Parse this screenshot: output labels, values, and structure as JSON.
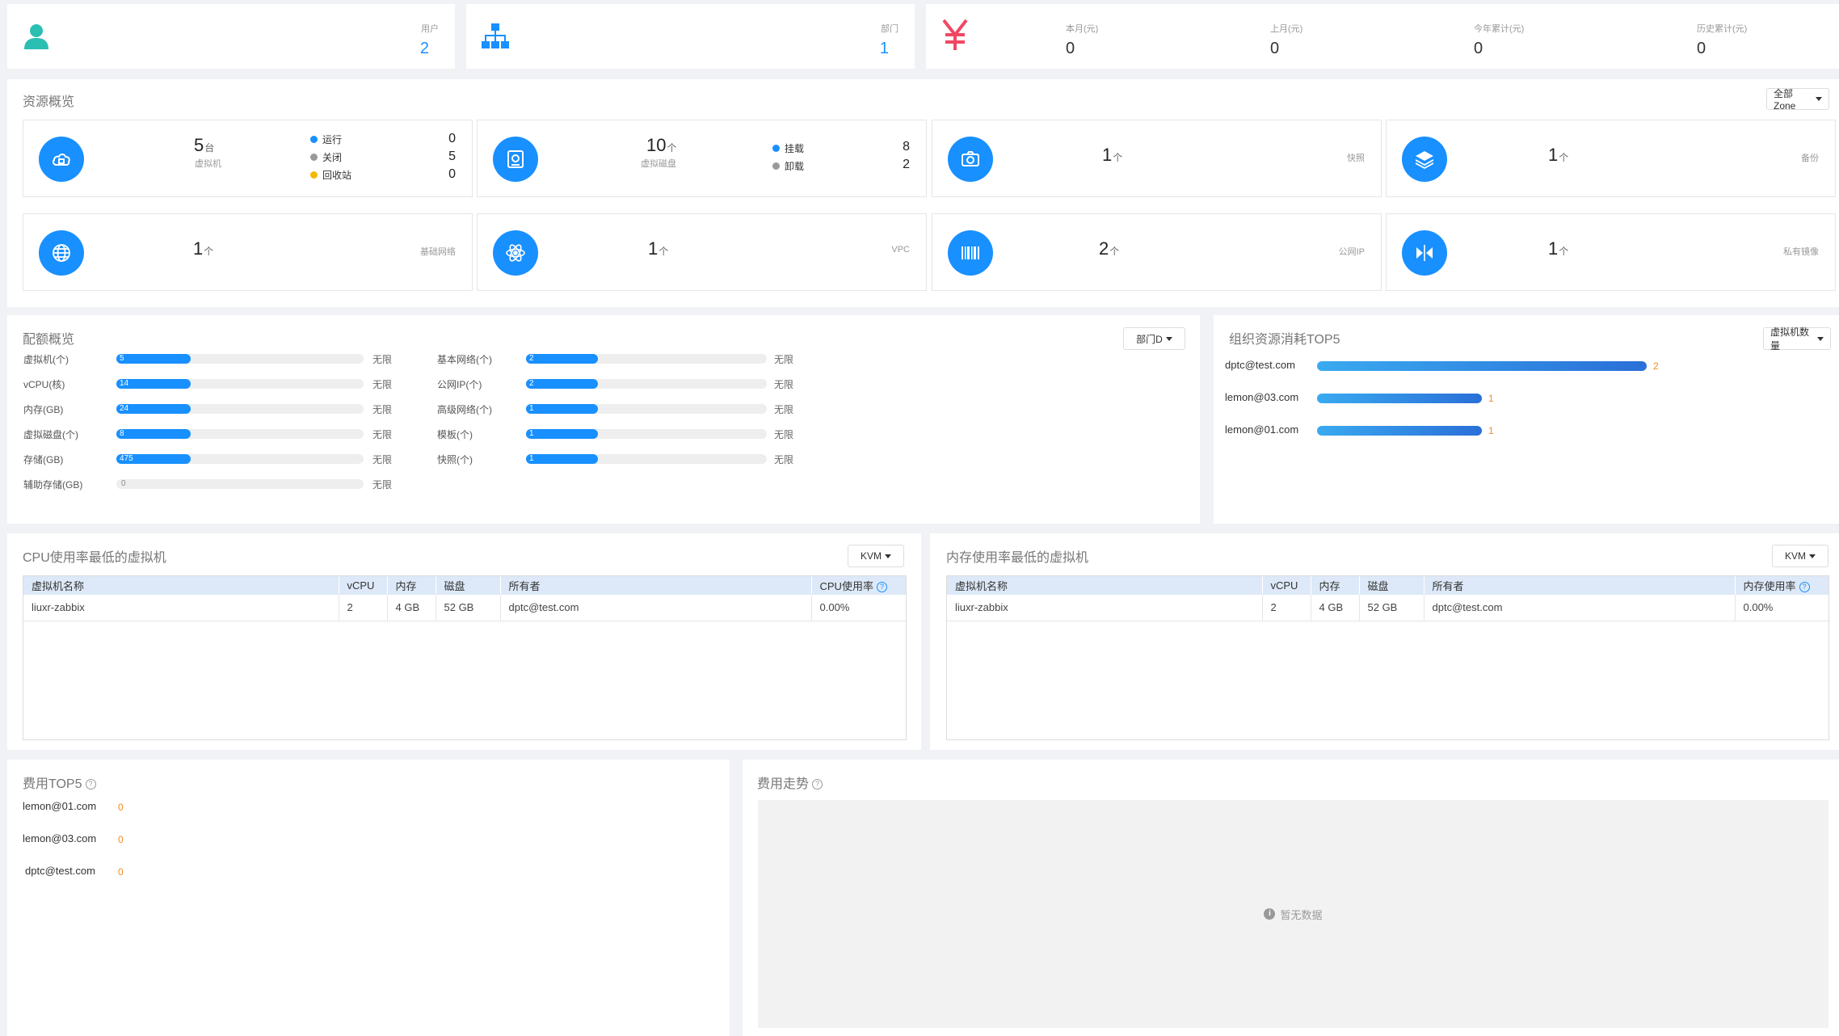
{
  "stats": {
    "users": {
      "label": "用户",
      "value": "2"
    },
    "departments": {
      "label": "部门",
      "value": "1"
    },
    "costs": [
      {
        "label": "本月(元)",
        "value": "0"
      },
      {
        "label": "上月(元)",
        "value": "0"
      },
      {
        "label": "今年累计(元)",
        "value": "0"
      },
      {
        "label": "历史累计(元)",
        "value": "0"
      }
    ]
  },
  "resources": {
    "title": "资源概览",
    "zone_select": "全部Zone",
    "vm": {
      "count": "5",
      "unit": "台",
      "label": "虚拟机",
      "legend": [
        {
          "label": "运行",
          "value": "0",
          "color": "#1890ff"
        },
        {
          "label": "关闭",
          "value": "5",
          "color": "#999999"
        },
        {
          "label": "回收站",
          "value": "0",
          "color": "#f5b800"
        }
      ]
    },
    "disk": {
      "count": "10",
      "unit": "个",
      "label": "虚拟磁盘",
      "legend": [
        {
          "label": "挂载",
          "value": "8",
          "color": "#1890ff"
        },
        {
          "label": "卸载",
          "value": "2",
          "color": "#999999"
        }
      ]
    },
    "snapshot": {
      "count": "1",
      "unit": "个",
      "label": "快照"
    },
    "backup": {
      "count": "1",
      "unit": "个",
      "label": "备份"
    },
    "network": {
      "count": "1",
      "unit": "个",
      "label": "基础网络"
    },
    "vpc": {
      "count": "1",
      "unit": "个",
      "label": "VPC"
    },
    "public_ip": {
      "count": "2",
      "unit": "个",
      "label": "公网IP"
    },
    "private_image": {
      "count": "1",
      "unit": "个",
      "label": "私有镜像"
    }
  },
  "quota": {
    "title": "配额概览",
    "dept_select": "部门D",
    "left": [
      {
        "label": "虚拟机(个)",
        "value": "5",
        "fraction": 0.3,
        "limit": "无限"
      },
      {
        "label": "vCPU(核)",
        "value": "14",
        "fraction": 0.3,
        "limit": "无限"
      },
      {
        "label": "内存(GB)",
        "value": "24",
        "fraction": 0.3,
        "limit": "无限"
      },
      {
        "label": "虚拟磁盘(个)",
        "value": "8",
        "fraction": 0.3,
        "limit": "无限"
      },
      {
        "label": "存储(GB)",
        "value": "475",
        "fraction": 0.3,
        "limit": "无限"
      },
      {
        "label": "辅助存储(GB)",
        "value": "0",
        "fraction": 0,
        "limit": "无限"
      }
    ],
    "right": [
      {
        "label": "基本网络(个)",
        "value": "2",
        "fraction": 0.3,
        "limit": "无限"
      },
      {
        "label": "公网IP(个)",
        "value": "2",
        "fraction": 0.3,
        "limit": "无限"
      },
      {
        "label": "高级网络(个)",
        "value": "1",
        "fraction": 0.3,
        "limit": "无限"
      },
      {
        "label": "模板(个)",
        "value": "1",
        "fraction": 0.3,
        "limit": "无限"
      },
      {
        "label": "快照(个)",
        "value": "1",
        "fraction": 0.3,
        "limit": "无限"
      }
    ]
  },
  "org_top5": {
    "title": "组织资源消耗TOP5",
    "select": "虚拟机数量",
    "items": [
      {
        "name": "dptc@test.com",
        "value": "2",
        "fraction": 1.0
      },
      {
        "name": "lemon@03.com",
        "value": "1",
        "fraction": 0.5
      },
      {
        "name": "lemon@01.com",
        "value": "1",
        "fraction": 0.5
      }
    ]
  },
  "cpu_low": {
    "title": "CPU使用率最低的虚拟机",
    "select": "KVM",
    "headers": [
      "虚拟机名称",
      "vCPU",
      "内存",
      "磁盘",
      "所有者",
      "CPU使用率"
    ],
    "rows": [
      [
        "liuxr-zabbix",
        "2",
        "4 GB",
        "52 GB",
        "dptc@test.com",
        "0.00%"
      ]
    ]
  },
  "mem_low": {
    "title": "内存使用率最低的虚拟机",
    "select": "KVM",
    "headers": [
      "虚拟机名称",
      "vCPU",
      "内存",
      "磁盘",
      "所有者",
      "内存使用率"
    ],
    "rows": [
      [
        "liuxr-zabbix",
        "2",
        "4 GB",
        "52 GB",
        "dptc@test.com",
        "0.00%"
      ]
    ]
  },
  "cost_top5": {
    "title": "费用TOP5",
    "items": [
      {
        "name": "lemon@01.com",
        "value": "0"
      },
      {
        "name": "lemon@03.com",
        "value": "0"
      },
      {
        "name": "dptc@test.com",
        "value": "0"
      }
    ]
  },
  "cost_trend": {
    "title": "费用走势",
    "empty": "暂无数据"
  }
}
